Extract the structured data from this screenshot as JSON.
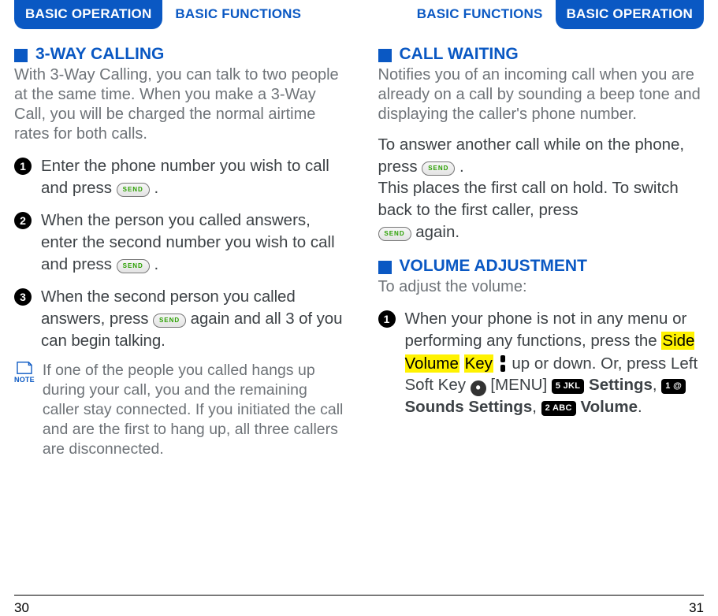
{
  "tabs": {
    "basic_operation": "BASIC OPERATION",
    "basic_functions": "BASIC FUNCTIONS"
  },
  "left": {
    "title": "3-WAY CALLING",
    "intro": "With 3-Way Calling, you can talk to two people at the same time. When you make a 3-Way Call, you will be charged the normal airtime rates for both calls.",
    "step1": "Enter the phone number you wish to call and press ",
    "step2a": "When the person you called answers, enter the second number you wish to call and press ",
    "step3a": "When the second person you called answers, press ",
    "step3b": " again and all 3 of you can begin talking.",
    "note": "If one of the people you called hangs up during your call, you and the remaining caller stay connected. If you initiated the call and are the first to hang up, all three callers are disconnected.",
    "note_label": "NOTE"
  },
  "right": {
    "cw_title": "CALL WAITING",
    "cw_intro": "Notifies you of an incoming call when you are already on a call by sounding a beep tone and displaying the caller's phone number.",
    "cw_body1a": "To answer another call while on the phone, press ",
    "cw_body1b": " .",
    "cw_body2a": "This places the first call on hold. To switch back to the first caller, press ",
    "cw_body2b": " again.",
    "vol_title": "VOLUME ADJUSTMENT",
    "vol_intro": "To adjust the volume:",
    "vol_step1a": "When your phone is not in any menu or performing any functions, press the ",
    "vol_step1_mark1": "Side Volume",
    "vol_step1_mark2": "Key",
    "vol_step1b": " up or down. Or, press Left Soft Key ",
    "vol_menu": " [MENU] ",
    "vol_settings": "Settings",
    "vol_sounds": " Sounds Settings",
    "vol_volume": " Volume",
    "period": ".",
    "comma": ", "
  },
  "keys": {
    "send": "SEND",
    "menu5": "5 JKL",
    "key1": "1    @",
    "key2": "2 ABC"
  },
  "page_numbers": {
    "left": "30",
    "right": "31"
  }
}
